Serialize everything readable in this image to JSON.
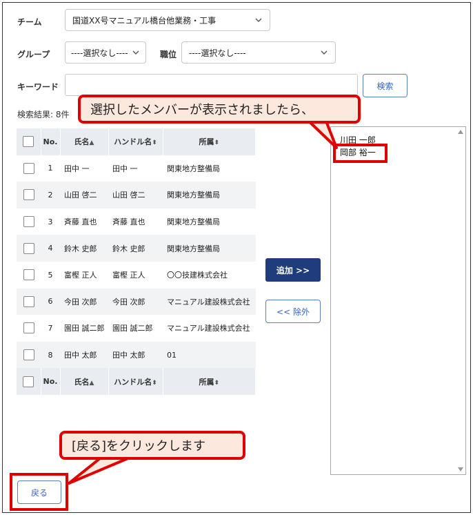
{
  "filters": {
    "team_label": "チーム",
    "team_value": "国道XX号マニュアル橋台他業務・工事",
    "group_label": "グループ",
    "group_value": "----選択なし----",
    "position_label": "職位",
    "position_value": "----選択なし----",
    "keyword_label": "キーワード",
    "keyword_value": "",
    "search_button": "検索"
  },
  "results": {
    "count_text": "検索結果: 8件",
    "columns": {
      "no": "No.",
      "name": "氏名",
      "handle": "ハンドル名",
      "org": "所属"
    },
    "name_sort_icon": "▲",
    "other_sort_icon": "⬍",
    "rows": [
      {
        "no": "1",
        "name": "田中 一",
        "handle": "田中 一",
        "org": "関東地方整備局"
      },
      {
        "no": "2",
        "name": "山田 啓二",
        "handle": "山田 啓二",
        "org": "関東地方整備局"
      },
      {
        "no": "3",
        "name": "斉藤 直也",
        "handle": "斉藤 直也",
        "org": "関東地方整備局"
      },
      {
        "no": "4",
        "name": "鈴木 史郎",
        "handle": "鈴木 史郎",
        "org": "関東地方整備局"
      },
      {
        "no": "5",
        "name": "富樫 正人",
        "handle": "富樫 正人",
        "org": "〇〇技建株式会社"
      },
      {
        "no": "6",
        "name": "今田 次郎",
        "handle": "今田 次郎",
        "org": "マニュアル建設株式会社"
      },
      {
        "no": "7",
        "name": "園田 誠二郎",
        "handle": "園田 誠二郎",
        "org": "マニュアル建設株式会社"
      },
      {
        "no": "8",
        "name": "田中 太郎",
        "handle": "田中 太郎",
        "org": "01"
      }
    ]
  },
  "actions": {
    "add_button": "追加 >>",
    "remove_button": "<< 除外",
    "back_button": "戻る"
  },
  "selected_members": [
    "川田 一郎",
    "岡部 裕一"
  ],
  "callouts": {
    "members_shown": "選択したメンバーが表示されましたら、",
    "click_back": "[戻る]をクリックします"
  },
  "colors": {
    "accent": "#1f3c7d",
    "annotation_red": "#e00000",
    "callout_fill": "#fde8dd"
  }
}
